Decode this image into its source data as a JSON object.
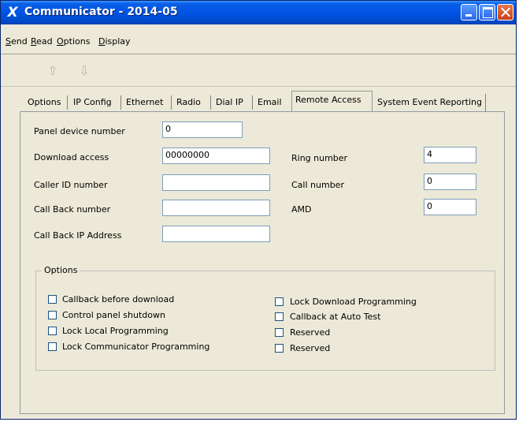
{
  "window": {
    "title": "Communicator - 2014-05"
  },
  "menu": [
    {
      "label": "Send"
    },
    {
      "label": "Read"
    },
    {
      "label": "Options"
    },
    {
      "label": "Display"
    }
  ],
  "toolbar": {
    "buttons": [
      {
        "name": "upload-icon",
        "glyph": "⇧"
      },
      {
        "name": "download-icon",
        "glyph": "⇩"
      }
    ]
  },
  "tabs": [
    {
      "label": "Options",
      "active": false
    },
    {
      "label": "IP Config",
      "active": false
    },
    {
      "label": "Ethernet",
      "active": false
    },
    {
      "label": "Radio",
      "active": false
    },
    {
      "label": "Dial IP",
      "active": false
    },
    {
      "label": "Email",
      "active": false
    },
    {
      "label": "Remote Access",
      "active": true
    },
    {
      "label": "System Event Reporting",
      "active": false
    }
  ],
  "form": {
    "panel_device_number": {
      "label": "Panel device number",
      "value": "0"
    },
    "download_access": {
      "label": "Download access",
      "value": "00000000"
    },
    "caller_id_number": {
      "label": "Caller ID number",
      "value": ""
    },
    "call_back_number": {
      "label": "Call Back number",
      "value": ""
    },
    "call_back_ip": {
      "label": "Call Back IP Address",
      "value": ""
    },
    "ring_number": {
      "label": "Ring number",
      "value": "4"
    },
    "call_number": {
      "label": "Call number",
      "value": "0"
    },
    "amd": {
      "label": "AMD",
      "value": "0"
    }
  },
  "options": {
    "title": "Options",
    "left": [
      {
        "label": "Callback before download",
        "checked": false
      },
      {
        "label": "Control panel shutdown",
        "checked": false
      },
      {
        "label": "Lock Local Programming",
        "checked": false
      },
      {
        "label": "Lock Communicator Programming",
        "checked": false
      }
    ],
    "right": [
      {
        "label": "Lock Download Programming",
        "checked": false
      },
      {
        "label": "Callback at Auto Test",
        "checked": false
      },
      {
        "label": "Reserved",
        "checked": false
      },
      {
        "label": "Reserved",
        "checked": false
      }
    ]
  }
}
